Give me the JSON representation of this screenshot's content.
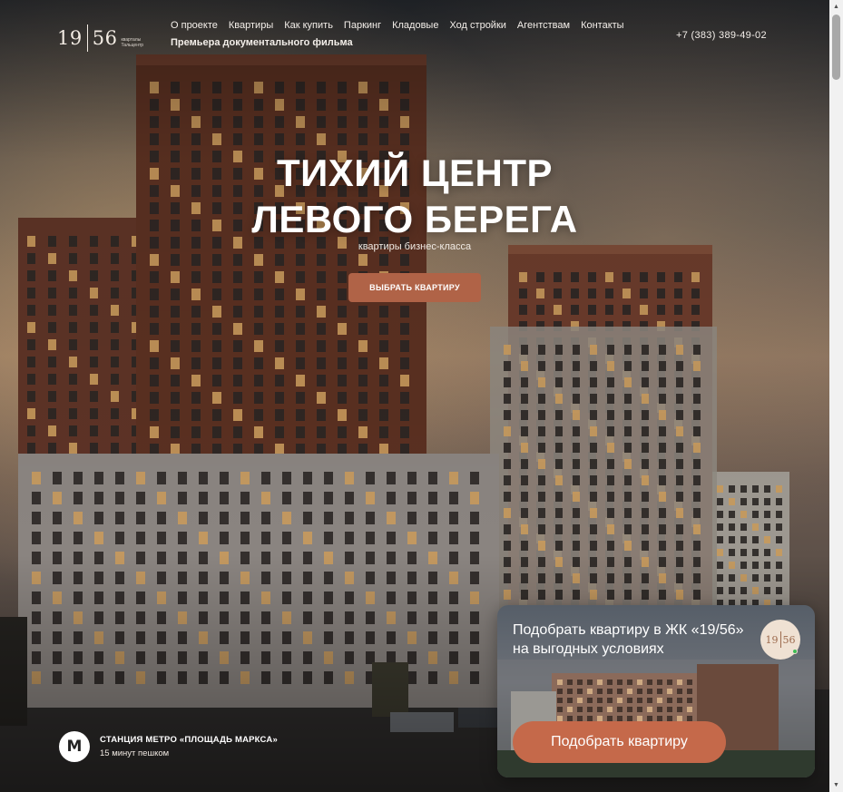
{
  "brand": {
    "logo_number_left": "19",
    "logo_number_right": "56",
    "logo_subtitle": "кварталы Тальцентр"
  },
  "nav": {
    "items": [
      {
        "label": "О проекте"
      },
      {
        "label": "Квартиры"
      },
      {
        "label": "Как купить"
      },
      {
        "label": "Паркинг"
      },
      {
        "label": "Кладовые"
      },
      {
        "label": "Ход стройки"
      },
      {
        "label": "Агентствам"
      },
      {
        "label": "Контакты"
      }
    ],
    "featured": "Премьера документального фильма"
  },
  "phone": "+7 (383) 389-49-02",
  "hero": {
    "title_line1": "ТИХИЙ ЦЕНТР",
    "title_line2": "ЛЕВОГО БЕРЕГА",
    "subtitle": "квартиры бизнес-класса",
    "cta_label": "ВЫБРАТЬ КВАРТИРУ"
  },
  "metro": {
    "icon": "metro-icon",
    "icon_glyph": "М",
    "station": "СТАНЦИЯ МЕТРО «ПЛОЩАДЬ МАРКСА»",
    "walk_time": "15 минут пешком"
  },
  "promo": {
    "title": "Подобрать квартиру в ЖК «19/56» на выгодных условиях",
    "badge_left": "19",
    "badge_right": "56",
    "button_label": "Подобрать квартиру"
  },
  "colors": {
    "accent": "#b06347",
    "promo_button": "#c5694a",
    "online_dot": "#3dbb55"
  },
  "scrollbar": {
    "up_icon": "scroll-up-arrow-icon",
    "down_icon": "scroll-down-arrow-icon"
  }
}
